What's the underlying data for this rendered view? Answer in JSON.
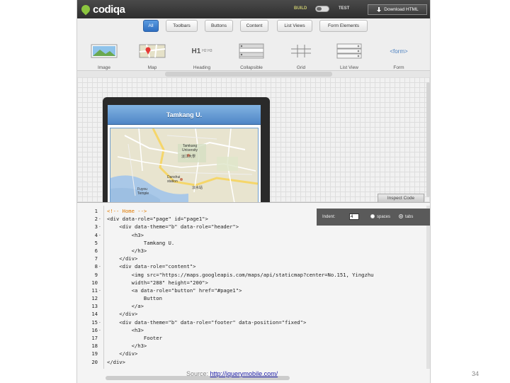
{
  "app": {
    "logo": "codiqa",
    "mode": {
      "build": "BUILD",
      "test": "TEST"
    },
    "download_label": "Download HTML"
  },
  "categories": [
    {
      "label": "All",
      "active": true
    },
    {
      "label": "Toolbars",
      "active": false
    },
    {
      "label": "Buttons",
      "active": false
    },
    {
      "label": "Content",
      "active": false
    },
    {
      "label": "List Views",
      "active": false
    },
    {
      "label": "Form Elements",
      "active": false
    }
  ],
  "widgets": [
    {
      "label": "Image",
      "icon": "image-icon"
    },
    {
      "label": "Map",
      "icon": "map-icon"
    },
    {
      "label": "Heading",
      "icon": "heading-icon",
      "sample": "H1",
      "sample_small": "H2 H3"
    },
    {
      "label": "Collapsible",
      "icon": "collapsible-icon"
    },
    {
      "label": "Grid",
      "icon": "grid-icon"
    },
    {
      "label": "List View",
      "icon": "list-view-icon"
    },
    {
      "label": "Form",
      "icon": "form-icon",
      "sample": "<form>"
    }
  ],
  "preview": {
    "header_title": "Tamkang U.",
    "map_labels": [
      "Tamkang University",
      "淡江大學",
      "Danshui station",
      "Fuyou Temple",
      "淡水站"
    ]
  },
  "inspect_label": "Inspect Code",
  "inspector": {
    "indent_label": "Indent:",
    "indent_value": "4",
    "spaces_label": "spaces",
    "tabs_label": "tabs",
    "selected": "tabs"
  },
  "code_lines": [
    {
      "n": "1",
      "fold": "",
      "text": "<!-- Home -->",
      "comment": true
    },
    {
      "n": "2",
      "fold": "-",
      "text": "<div data-role=\"page\" id=\"page1\">"
    },
    {
      "n": "3",
      "fold": "-",
      "text": "    <div data-theme=\"b\" data-role=\"header\">"
    },
    {
      "n": "4",
      "fold": "-",
      "text": "        <h3>"
    },
    {
      "n": "5",
      "fold": "",
      "text": "            Tamkang U."
    },
    {
      "n": "6",
      "fold": "",
      "text": "        </h3>"
    },
    {
      "n": "7",
      "fold": "",
      "text": "    </div>"
    },
    {
      "n": "8",
      "fold": "-",
      "text": "    <div data-role=\"content\">"
    },
    {
      "n": "9",
      "fold": "",
      "text": "        <img src=\"https://maps.googleapis.com/maps/api/staticmap?center=No.151, Yingzhu"
    },
    {
      "n": "10",
      "fold": "",
      "text": "        width=\"288\" height=\"200\">"
    },
    {
      "n": "11",
      "fold": "-",
      "text": "        <a data-role=\"button\" href=\"#page1\">"
    },
    {
      "n": "12",
      "fold": "",
      "text": "            Button"
    },
    {
      "n": "13",
      "fold": "",
      "text": "        </a>"
    },
    {
      "n": "14",
      "fold": "",
      "text": "    </div>"
    },
    {
      "n": "15",
      "fold": "-",
      "text": "    <div data-theme=\"b\" data-role=\"footer\" data-position=\"fixed\">"
    },
    {
      "n": "16",
      "fold": "-",
      "text": "        <h3>"
    },
    {
      "n": "17",
      "fold": "",
      "text": "            Footer"
    },
    {
      "n": "18",
      "fold": "",
      "text": "        </h3>"
    },
    {
      "n": "19",
      "fold": "",
      "text": "    </div>"
    },
    {
      "n": "20",
      "fold": "",
      "text": "</div>"
    }
  ],
  "footer": {
    "source_prefix": "Source: ",
    "source_link": "http://jquerymobile.com/",
    "page_number": "34"
  },
  "colors": {
    "header_blue": "#4f86c6",
    "active_tab": "#2f6fc1",
    "logo_green": "#8cc63f",
    "comment": "#e07a00"
  }
}
